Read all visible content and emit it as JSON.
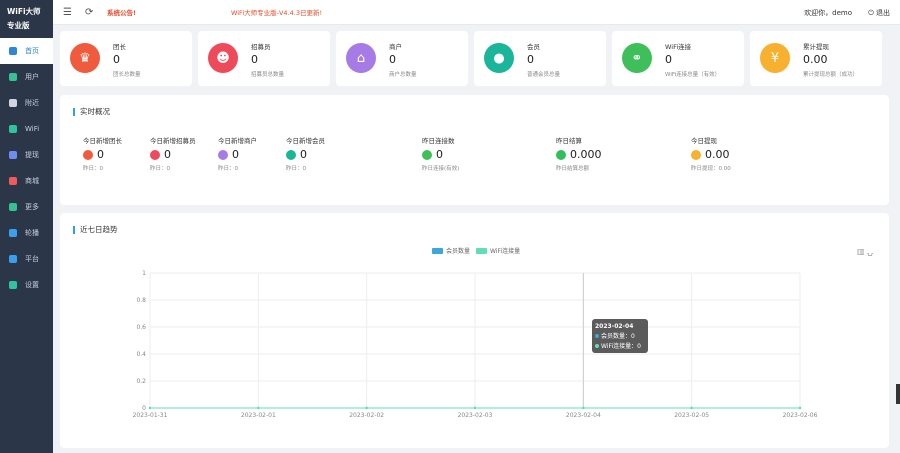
{
  "brand": {
    "title": "WiFi大师专业版"
  },
  "sidebar": {
    "items": [
      {
        "label": "首页",
        "color": "#2b87d8"
      },
      {
        "label": "用户",
        "color": "#34c28e"
      },
      {
        "label": "附近",
        "color": "#d0d6e0"
      },
      {
        "label": "WiFi",
        "color": "#2fc4a0"
      },
      {
        "label": "提现",
        "color": "#6d8ef0"
      },
      {
        "label": "商城",
        "color": "#f05a5a"
      },
      {
        "label": "更多",
        "color": "#34c28e"
      },
      {
        "label": "轮播",
        "color": "#3b9ff0"
      },
      {
        "label": "平台",
        "color": "#3b9ff0"
      },
      {
        "label": "设置",
        "color": "#2fc4a0"
      }
    ]
  },
  "topbar": {
    "notice_label": "系统公告!",
    "notice_text": "WiFi大师专业版-V4.4.3已更新!",
    "welcome": "欢迎你，demo",
    "logout": "退出"
  },
  "cards": [
    {
      "title": "团长",
      "value": "0",
      "sub": "团长总数量",
      "color": "#ef5b3c",
      "icon": "crown-icon",
      "glyph": "♛"
    },
    {
      "title": "招募员",
      "value": "0",
      "sub": "招募员总数量",
      "color": "#ef4a5a",
      "icon": "recruiter-icon",
      "glyph": "☻"
    },
    {
      "title": "商户",
      "value": "0",
      "sub": "商户总数量",
      "color": "#a77be6",
      "icon": "store-icon",
      "glyph": "⌂"
    },
    {
      "title": "会员",
      "value": "0",
      "sub": "普通会员总量",
      "color": "#1bb59a",
      "icon": "member-icon",
      "glyph": "●"
    },
    {
      "title": "WiFi连接",
      "value": "0",
      "sub": "WiFi连接总量（有效）",
      "color": "#3fbf5a",
      "icon": "link-icon",
      "glyph": "⚭"
    },
    {
      "title": "累计提现",
      "value": "0.00",
      "sub": "累计提现总额（成功）",
      "color": "#f7b12e",
      "icon": "withdraw-icon",
      "glyph": "¥"
    }
  ],
  "realtime": {
    "title": "实时概况",
    "items": [
      {
        "label": "今日新增团长",
        "value": "0",
        "yesterday": "昨日：0",
        "color": "#ef5b3c"
      },
      {
        "label": "今日新增招募员",
        "value": "0",
        "yesterday": "昨日：0",
        "color": "#ef4a5a"
      },
      {
        "label": "今日新增商户",
        "value": "0",
        "yesterday": "昨日：0",
        "color": "#a77be6"
      },
      {
        "label": "今日新增会员",
        "value": "0",
        "yesterday": "昨日：0",
        "color": "#1bb59a"
      },
      {
        "label": "昨日连接数",
        "value": "0",
        "yesterday": "昨日连接(有效)",
        "color": "#3fbf5a"
      },
      {
        "label": "昨日结算",
        "value": "0.000",
        "yesterday": "昨日结算总额",
        "color": "#2fbf5f"
      },
      {
        "label": "今日提现",
        "value": "0.00",
        "yesterday": "昨日提现：0.00",
        "color": "#f7b12e"
      }
    ]
  },
  "trend": {
    "title": "近七日趋势",
    "legend": [
      "会员数量",
      "WiFi连接量"
    ],
    "legend_colors": [
      "#3ba8d8",
      "#5fe0b4"
    ],
    "tooltip": {
      "date": "2023-02-04",
      "line1": "会员数量：0",
      "line2": "WiFi连接量：0"
    }
  },
  "chart_data": {
    "type": "line",
    "categories": [
      "2023-01-31",
      "2023-02-01",
      "2023-02-02",
      "2023-02-03",
      "2023-02-04",
      "2023-02-05",
      "2023-02-06"
    ],
    "series": [
      {
        "name": "会员数量",
        "values": [
          0,
          0,
          0,
          0,
          0,
          0,
          0
        ]
      },
      {
        "name": "WiFi连接量",
        "values": [
          0,
          0,
          0,
          0,
          0,
          0,
          0
        ]
      }
    ],
    "yticks": [
      "0",
      "0.2",
      "0.4",
      "0.6",
      "0.8",
      "1"
    ],
    "ylim": [
      0,
      1
    ],
    "grid": true,
    "legend_position": "top-center"
  }
}
